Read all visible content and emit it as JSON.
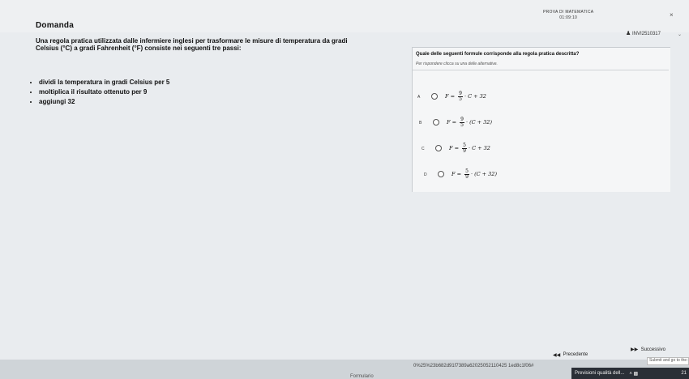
{
  "header": {
    "section_title": "Domanda",
    "test_name": "PROVA DI MATEMATICA",
    "timer": "01:09:10",
    "user_code": "INVI2510317",
    "close_glyph": "×"
  },
  "question": {
    "intro_line1": "Una regola pratica utilizzata dalle infermiere inglesi per trasformare le misure di temperatura da gradi",
    "intro_line2": "Celsius (°C) a gradi Fahrenheit (°F) consiste nei seguenti tre passi:",
    "steps": [
      "dividi la temperatura in gradi Celsius per 5",
      "moltiplica il risultato ottenuto per 9",
      "aggiungi 32"
    ]
  },
  "answer_panel": {
    "prompt": "Quale delle seguenti formule corrisponde alla regola pratica descritta?",
    "hint": "Per rispondere clicca su una delle alternative.",
    "options": [
      {
        "letter": "A",
        "lhs": "F",
        "eq": "=",
        "num": "9",
        "den": "5",
        "rhs": "· C + 32"
      },
      {
        "letter": "B",
        "lhs": "F",
        "eq": "=",
        "num": "9",
        "den": "5",
        "rhs": "· (C + 32)"
      },
      {
        "letter": "C",
        "lhs": "F",
        "eq": "=",
        "num": "5",
        "den": "9",
        "rhs": "· C + 32"
      },
      {
        "letter": "D",
        "lhs": "F",
        "eq": "=",
        "num": "5",
        "den": "9",
        "rhs": "· (C + 32)"
      }
    ]
  },
  "footer": {
    "formulario": "Formulario",
    "hash": "0%25%23b682d91f7389a62025052110425 1ed8c1f06#",
    "prev_label": "Precedente",
    "next_label": "Successivo",
    "submit_hint": "Submit and go to the r",
    "taskbar_quality": "Previsioni qualità dell...",
    "taskbar_clock": "21"
  },
  "icons": {
    "user": "user-icon",
    "prev": "double-left-arrow-icon",
    "next": "double-right-arrow-icon",
    "chevron": "chevron-down-icon"
  }
}
